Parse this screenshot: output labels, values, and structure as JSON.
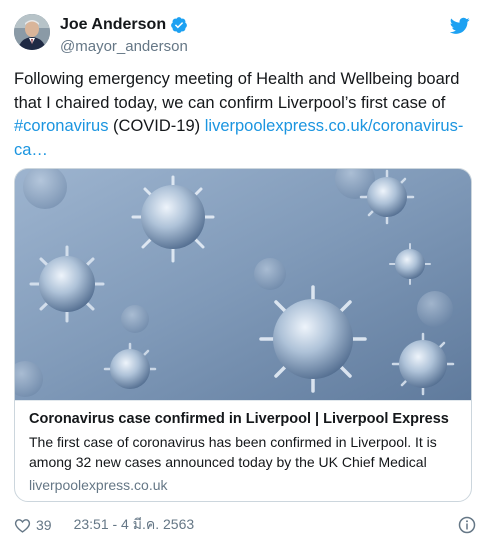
{
  "author": {
    "name": "Joe Anderson",
    "handle": "@mayor_anderson",
    "verified": true,
    "avatar_icon": "avatar-photo"
  },
  "tweet": {
    "text_lines": [
      "Following emergency meeting of Health and Wellbeing board",
      "that I chaired today, we can confirm Liverpool’s first case of"
    ],
    "hashtag": "#coronavirus",
    "text_after_hashtag": " (COVID-19) ",
    "link_part1": "liverpoolexpress.co.uk/coronavirus-",
    "link_part2": "ca…"
  },
  "card": {
    "title": "Coronavirus case confirmed in Liverpool | Liverpool Express",
    "description": "The first case of coronavirus has been confirmed in Liverpool. It is among 32 new cases announced today by the UK Chief Medical",
    "domain": "liverpoolexpress.co.uk",
    "image_icon": "coronavirus-illustration"
  },
  "footer": {
    "likes": "39",
    "timestamp": "23:51 - 4 มี.ค. 2563"
  },
  "colors": {
    "link": "#1b95e0",
    "secondary_text": "#657786",
    "border": "#ccd6dd",
    "verified_badge": "#1da1f2"
  }
}
